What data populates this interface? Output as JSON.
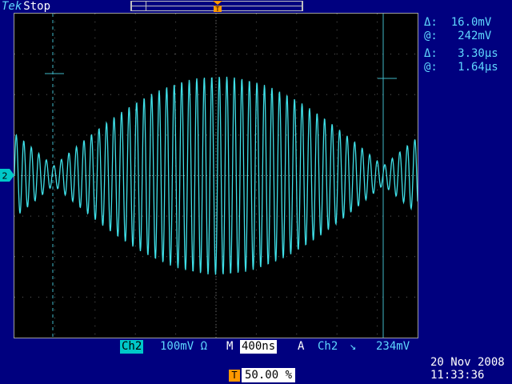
{
  "status": {
    "brand": "Tek",
    "state": "Stop"
  },
  "markers": {
    "channel_number": "2",
    "trigger_letter": "T"
  },
  "cursor_readout": {
    "voltage_delta": "Δ:  16.0mV",
    "voltage_at": "@:   242mV",
    "time_delta": "Δ:   3.30μs",
    "time_at": "@:   1.64μs"
  },
  "bottom_bar": {
    "channel": "Ch2",
    "vertical_scale": "100mV Ω",
    "mode_letter": "M",
    "time_scale": "400ns",
    "trigger_mode": "A",
    "trigger_source": "Ch2",
    "trigger_slope": "↘",
    "trigger_level": "234mV",
    "position_icon": "T",
    "position_value": "50.00 %"
  },
  "datetime": {
    "date": "20 Nov 2008",
    "time": "11:33:36"
  },
  "colors": {
    "background": "#00007f",
    "trace": "#3fe0e8",
    "trigger": "#ff9900",
    "screen": "#000000"
  },
  "icons": {
    "channel_marker": "channel-2-arrow-icon",
    "trigger_marker": "trigger-t-icon"
  }
}
